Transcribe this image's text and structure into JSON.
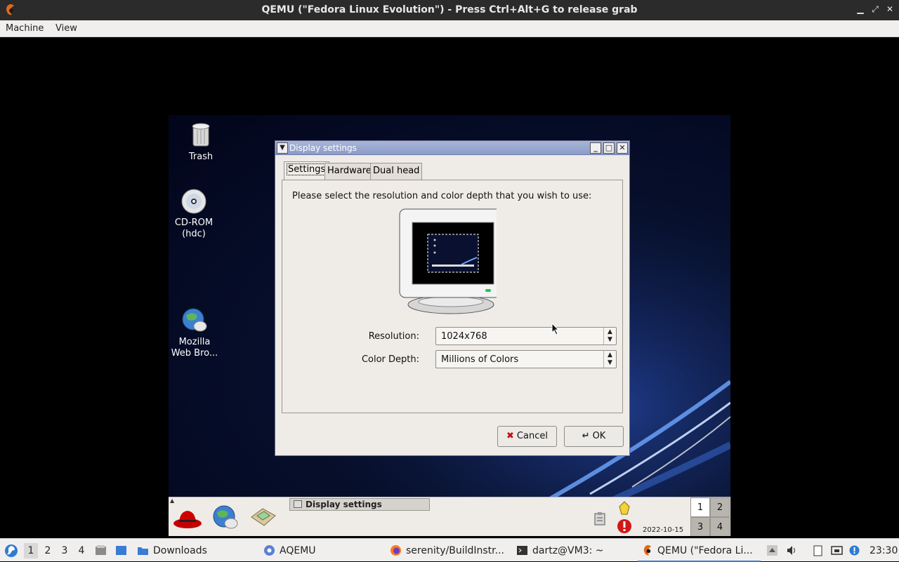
{
  "host_window": {
    "title": "QEMU (\"Fedora Linux Evolution\") - Press Ctrl+Alt+G to release grab",
    "menu": [
      "Machine",
      "View"
    ]
  },
  "desktop_icons": [
    {
      "label": "Trash",
      "icon": "trash-icon"
    },
    {
      "label": "CD-ROM\n(hdc)",
      "icon": "cdrom-icon"
    },
    {
      "label": "Mozilla\nWeb Bro...",
      "icon": "browser-globe-icon"
    }
  ],
  "dialog": {
    "title": "Display settings",
    "tabs": [
      {
        "label": "Settings",
        "active": true
      },
      {
        "label": "Hardware",
        "active": false
      },
      {
        "label": "Dual head",
        "active": false
      }
    ],
    "instruction": "Please select the resolution and color depth that you wish to use:",
    "resolution": {
      "label": "Resolution:",
      "value": "1024x768"
    },
    "color_depth": {
      "label": "Color Depth:",
      "value": "Millions of Colors"
    },
    "buttons": {
      "cancel": "Cancel",
      "ok": "OK"
    }
  },
  "guest_panel": {
    "task_button": "Display settings",
    "date": "2022-10-15",
    "pager": [
      "1",
      "2",
      "3",
      "4"
    ],
    "active_workspace": "1"
  },
  "host_taskbar": {
    "workspaces": [
      "1",
      "2",
      "3",
      "4"
    ],
    "active_workspace": "1",
    "tasks": [
      {
        "label": "Downloads",
        "icon": "folder-icon"
      },
      {
        "label": "AQEMU",
        "icon": "aqemu-icon"
      },
      {
        "label": "serenity/BuildInstr...",
        "icon": "firefox-icon"
      },
      {
        "label": "dartz@VM3: ~",
        "icon": "terminal-icon"
      },
      {
        "label": "QEMU (\"Fedora Li...",
        "icon": "qemu-icon",
        "active": true
      }
    ],
    "clock": "23:30"
  }
}
